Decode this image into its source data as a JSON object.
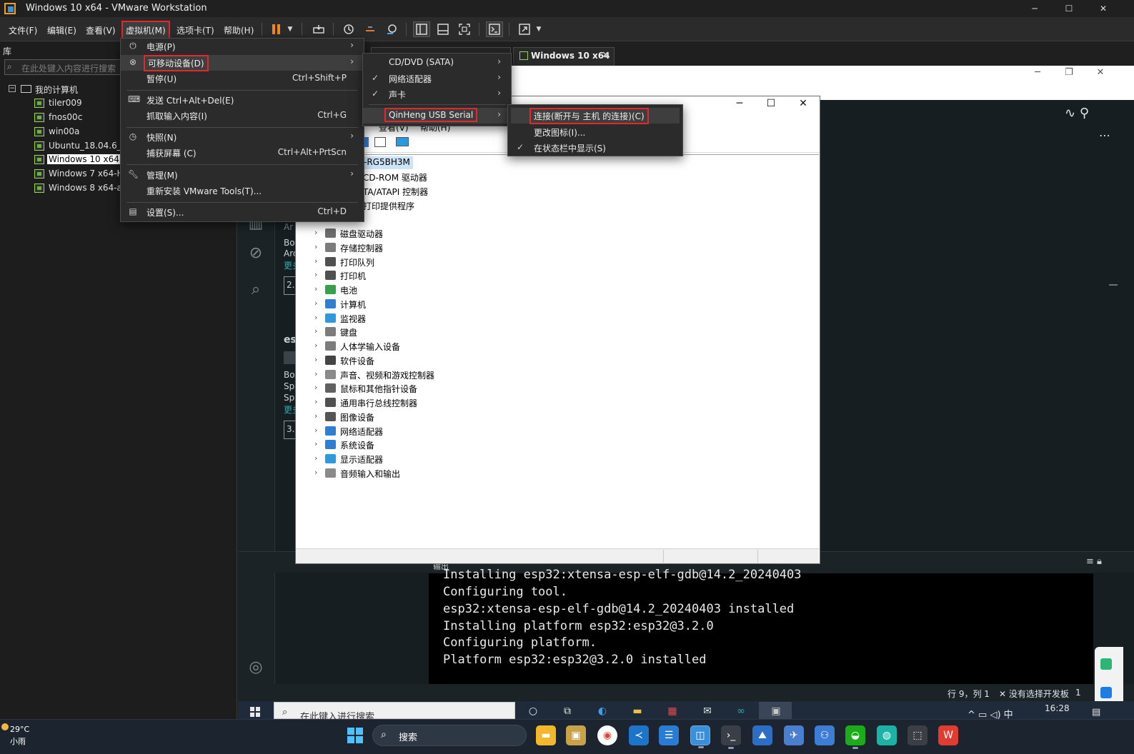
{
  "window": {
    "title": "Windows 10 x64 - VMware Workstation",
    "controls": {
      "minimize": "─",
      "maximize": "☐",
      "close": "✕"
    }
  },
  "menubar": [
    {
      "label": "文件(F)"
    },
    {
      "label": "编辑(E)"
    },
    {
      "label": "查看(V)"
    },
    {
      "label": "虚拟机(M)",
      "active": true
    },
    {
      "label": "选项卡(T)"
    },
    {
      "label": "帮助(H)"
    }
  ],
  "library": {
    "title": "库",
    "search_placeholder": "在此处键入内容进行搜索",
    "root": "我的计算机",
    "items": [
      {
        "label": "tiler009"
      },
      {
        "label": "fnos00c"
      },
      {
        "label": "win00a"
      },
      {
        "label": "Ubuntu_18.04.6_V"
      },
      {
        "label": "Windows 10 x64",
        "selected": true
      },
      {
        "label": "Windows 7 x64-H"
      },
      {
        "label": "Windows 8 x64-a"
      }
    ]
  },
  "vm_tab": {
    "label": "Windows 10 x64",
    "close": "✕"
  },
  "guest_controls": {
    "minimize": "─",
    "restore": "❐",
    "close": "✕"
  },
  "vm_menu": {
    "items": [
      {
        "icon": "power-icon",
        "label": "电源(P)",
        "submenu": true
      },
      {
        "icon": "usb-icon",
        "label": "可移动设备(D)",
        "submenu": true,
        "highlighted": true,
        "boxed": true
      },
      {
        "label": "暂停(U)",
        "shortcut": "Ctrl+Shift+P"
      },
      {
        "separator": true
      },
      {
        "icon": "keyboard-icon",
        "label": "发送 Ctrl+Alt+Del(E)"
      },
      {
        "label": "抓取输入内容(I)",
        "shortcut": "Ctrl+G"
      },
      {
        "separator": true
      },
      {
        "icon": "snapshot-icon",
        "label": "快照(N)",
        "submenu": true
      },
      {
        "label": "捕获屏幕 (C)",
        "shortcut": "Ctrl+Alt+PrtScn"
      },
      {
        "separator": true
      },
      {
        "icon": "wrench-icon",
        "label": "管理(M)",
        "submenu": true
      },
      {
        "label": "重新安装 VMware Tools(T)..."
      },
      {
        "separator": true
      },
      {
        "icon": "settings-icon",
        "label": "设置(S)...",
        "shortcut": "Ctrl+D"
      }
    ]
  },
  "devices_menu": {
    "items": [
      {
        "label": "CD/DVD (SATA)",
        "checked": false
      },
      {
        "label": "网络适配器",
        "checked": true
      },
      {
        "label": "声卡",
        "checked": true
      },
      {
        "label": "QinHeng USB Serial",
        "checked": false,
        "boxed": true
      }
    ]
  },
  "usb_menu": {
    "items": [
      {
        "label": "连接(断开与 主机 的连接)(C)",
        "checked": false,
        "boxed": true
      },
      {
        "label": "更改图标(I)...",
        "checked": false
      },
      {
        "label": "在状态栏中显示(S)",
        "checked": true
      }
    ]
  },
  "device_manager": {
    "menu_partial": [
      "查看(V)",
      "帮助(H)"
    ],
    "root": "-RG5BH3M",
    "partial_nodes": [
      "CD-ROM 驱动器",
      "TA/ATAPI 控制器",
      "打印提供程序"
    ],
    "nodes": [
      {
        "label": "磁盘驱动器",
        "color": "#6d6d6d"
      },
      {
        "label": "存储控制器",
        "color": "#7a7a7a"
      },
      {
        "label": "打印队列",
        "color": "#505050"
      },
      {
        "label": "打印机",
        "color": "#505050"
      },
      {
        "label": "电池",
        "color": "#37a04a"
      },
      {
        "label": "计算机",
        "color": "#2d7fd3"
      },
      {
        "label": "监视器",
        "color": "#2d9ae0"
      },
      {
        "label": "键盘",
        "color": "#7c7c7c"
      },
      {
        "label": "人体学输入设备",
        "color": "#7c7c7c"
      },
      {
        "label": "软件设备",
        "color": "#444444"
      },
      {
        "label": "声音、视频和游戏控制器",
        "color": "#8a8a8a"
      },
      {
        "label": "鼠标和其他指针设备",
        "color": "#606060"
      },
      {
        "label": "通用串行总线控制器",
        "color": "#505050"
      },
      {
        "label": "图像设备",
        "color": "#555555"
      },
      {
        "label": "网络适配器",
        "color": "#2d7fd3"
      },
      {
        "label": "系统设备",
        "color": "#2d7fd3"
      },
      {
        "label": "显示适配器",
        "color": "#2d9ae0"
      },
      {
        "label": "音频输入和输出",
        "color": "#8a8a8a"
      }
    ],
    "controls": {
      "minimize": "─",
      "maximize": "☐",
      "close": "✕"
    }
  },
  "ide": {
    "fragments": {
      "a1": "Ar",
      "b1": "Bo",
      "b2": "Arc",
      "more1": "更多",
      "box1": "2.",
      "es": "es",
      "c1": "Bo",
      "c2": "Sp",
      "c3": "Sp",
      "more2": "更多",
      "box2": "3."
    },
    "output_title": "输出",
    "output_lines": [
      "Installing esp32:xtensa-esp-elf-gdb@14.2_20240403",
      "Configuring tool.",
      "esp32:xtensa-esp-elf-gdb@14.2_20240403 installed",
      "Installing platform esp32:esp32@3.2.0",
      "Configuring platform.",
      "Platform esp32:esp32@3.2.0 installed"
    ],
    "status": {
      "position": "行 9，列 1",
      "board": "✕ 没有选择开发板",
      "count": "1"
    }
  },
  "guest_taskbar": {
    "search_placeholder": "在此键入进行搜索",
    "clock": "16:28",
    "ime": "中"
  },
  "host_taskbar": {
    "weather_temp": "29°C",
    "weather_desc": "小雨",
    "search_label": "搜索"
  },
  "colors": {
    "accent_red": "#e5262c",
    "vm_green": "#9bd35c",
    "selection_blue": "#cce4f7",
    "ide_teal": "#2fa9b0"
  }
}
